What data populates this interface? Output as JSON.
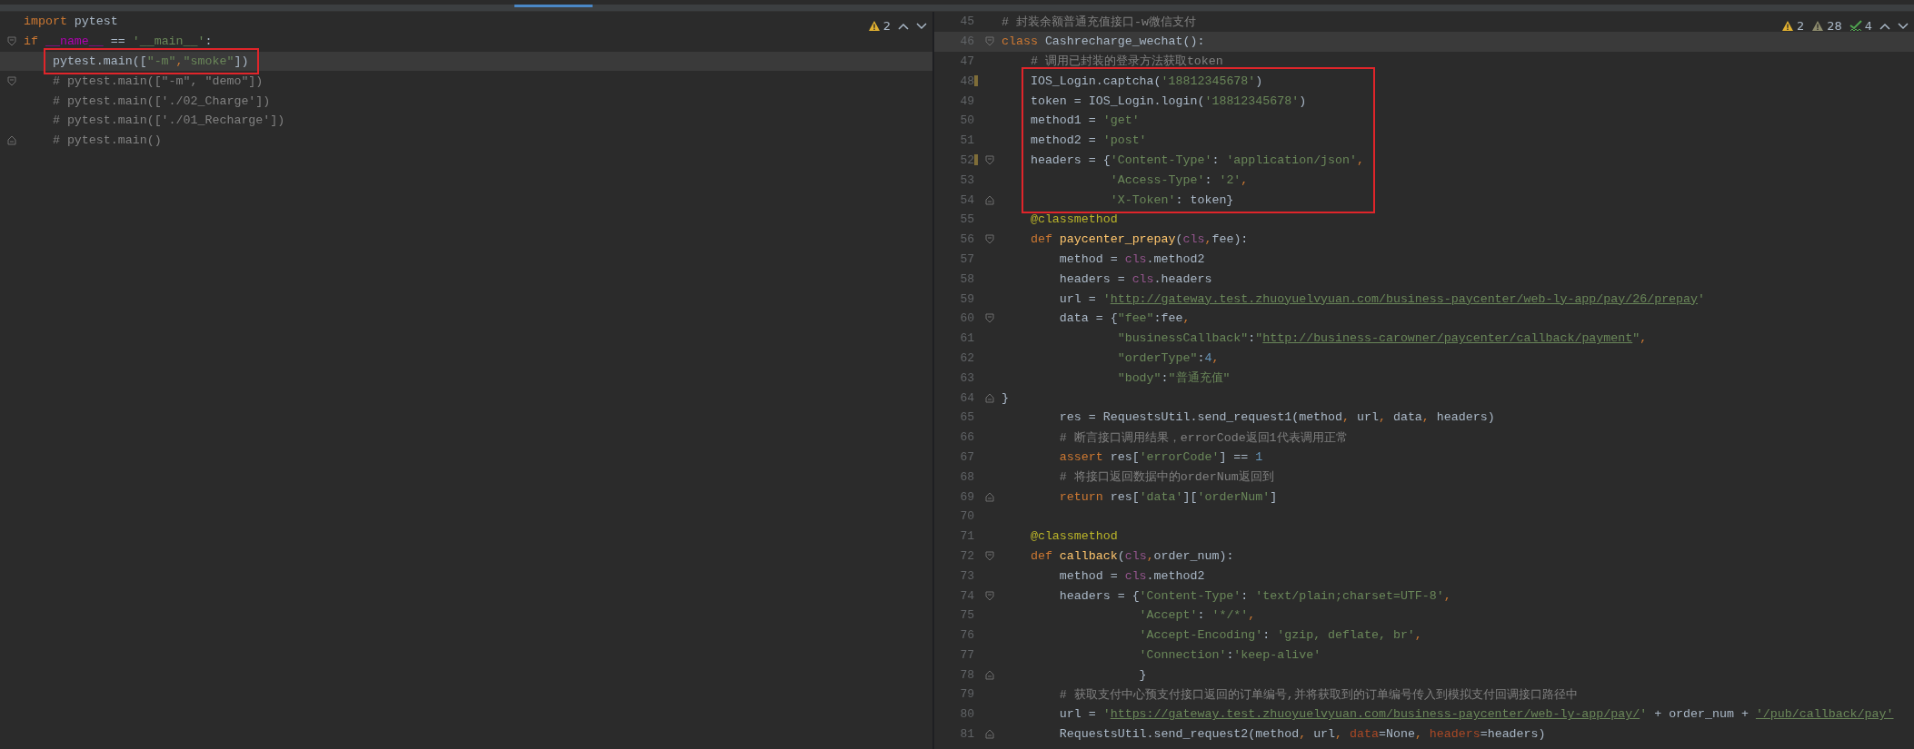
{
  "panes": [
    {
      "inspections": [
        {
          "kind": "warning",
          "count": "2"
        }
      ],
      "lines": [
        {
          "kind": "line",
          "current": false,
          "tokens": [
            {
              "kind": "kw",
              "text": "import "
            },
            {
              "kind": "plain",
              "text": "pytest"
            }
          ]
        },
        {
          "kind": "fold_start",
          "current": false,
          "tokens": [
            {
              "kind": "kw",
              "text": "if "
            },
            {
              "kind": "dunder",
              "text": "__name__"
            },
            {
              "kind": "plain",
              "text": " == "
            },
            {
              "kind": "str",
              "text": "'__main__'"
            },
            {
              "kind": "plain",
              "text": ":"
            }
          ]
        },
        {
          "kind": "frame",
          "lines": [
            {
              "kind": "line",
              "current": true,
              "tokens": [
                {
                  "kind": "plain",
                  "text": "    pytest.main(["
                },
                {
                  "kind": "str",
                  "text": "\"-m\""
                },
                {
                  "kind": "punct",
                  "text": ","
                },
                {
                  "kind": "str",
                  "text": "\"smoke\""
                },
                {
                  "kind": "plain",
                  "text": "])"
                }
              ]
            }
          ]
        },
        {
          "kind": "fold_start",
          "current": false,
          "tokens": [
            {
              "kind": "com",
              "text": "    # pytest.main([\"-m\", \"demo\"])"
            }
          ]
        },
        {
          "kind": "line",
          "current": false,
          "tokens": [
            {
              "kind": "com",
              "text": "    # pytest.main(['./02_Charge'])"
            }
          ]
        },
        {
          "kind": "line",
          "current": false,
          "tokens": [
            {
              "kind": "com",
              "text": "    # pytest.main(['./01_Recharge'])"
            }
          ]
        },
        {
          "kind": "fold_end",
          "current": false,
          "tokens": [
            {
              "kind": "com",
              "text": "    # pytest.main()"
            }
          ]
        }
      ]
    },
    {
      "inspections": [
        {
          "kind": "warning",
          "count": "2"
        },
        {
          "kind": "weak",
          "count": "28"
        },
        {
          "kind": "typo",
          "count": "4"
        }
      ],
      "lines": [
        {
          "kind": "line",
          "number": "45",
          "current": false,
          "changed": false,
          "tokens": [
            {
              "kind": "com",
              "text": "# 封装余额普通充值接口-w微信支付"
            }
          ]
        },
        {
          "kind": "fold_start",
          "number": "46",
          "current": true,
          "changed": false,
          "tokens": [
            {
              "kind": "kw",
              "text": "class "
            },
            {
              "kind": "plain",
              "text": "Cashrecharge_wechat():"
            }
          ]
        },
        {
          "kind": "line",
          "number": "47",
          "current": false,
          "changed": false,
          "tokens": [
            {
              "kind": "com",
              "text": "    # 调用已封装的登录方法获取token"
            }
          ]
        },
        {
          "kind": "frame",
          "lines": [
            {
              "kind": "line",
              "number": "48",
              "current": false,
              "changed": true,
              "tokens": [
                {
                  "kind": "plain",
                  "text": "    IOS_Login.captcha("
                },
                {
                  "kind": "str",
                  "text": "'18812345678'"
                },
                {
                  "kind": "plain",
                  "text": ")"
                }
              ]
            },
            {
              "kind": "line",
              "number": "49",
              "current": false,
              "changed": false,
              "tokens": [
                {
                  "kind": "plain",
                  "text": "    token = IOS_Login.login("
                },
                {
                  "kind": "str",
                  "text": "'18812345678'"
                },
                {
                  "kind": "plain",
                  "text": ")"
                }
              ]
            },
            {
              "kind": "line",
              "number": "50",
              "current": false,
              "changed": false,
              "tokens": [
                {
                  "kind": "plain",
                  "text": "    method1 = "
                },
                {
                  "kind": "str",
                  "text": "'get'"
                }
              ]
            },
            {
              "kind": "line",
              "number": "51",
              "current": false,
              "changed": false,
              "tokens": [
                {
                  "kind": "plain",
                  "text": "    method2 = "
                },
                {
                  "kind": "str",
                  "text": "'post'"
                }
              ]
            },
            {
              "kind": "fold_start",
              "number": "52",
              "current": false,
              "changed": true,
              "tokens": [
                {
                  "kind": "plain",
                  "text": "    headers = {"
                },
                {
                  "kind": "str",
                  "text": "'Content-Type'"
                },
                {
                  "kind": "plain",
                  "text": ": "
                },
                {
                  "kind": "str",
                  "text": "'application/json'"
                },
                {
                  "kind": "punct",
                  "text": ","
                }
              ]
            },
            {
              "kind": "line",
              "number": "53",
              "current": false,
              "changed": false,
              "tokens": [
                {
                  "kind": "str",
                  "text": "               'Access-Type'"
                },
                {
                  "kind": "plain",
                  "text": ": "
                },
                {
                  "kind": "str",
                  "text": "'2'"
                },
                {
                  "kind": "punct",
                  "text": ","
                }
              ]
            },
            {
              "kind": "fold_end",
              "number": "54",
              "current": false,
              "changed": false,
              "tokens": [
                {
                  "kind": "str",
                  "text": "               'X-Token'"
                },
                {
                  "kind": "plain",
                  "text": ": token}"
                }
              ]
            }
          ]
        },
        {
          "kind": "line",
          "number": "55",
          "current": false,
          "changed": false,
          "tokens": [
            {
              "kind": "deco",
              "text": "    @classmethod"
            }
          ]
        },
        {
          "kind": "fold_start",
          "number": "56",
          "current": false,
          "changed": false,
          "tokens": [
            {
              "kind": "kw",
              "text": "    def "
            },
            {
              "kind": "fn",
              "text": "paycenter_prepay"
            },
            {
              "kind": "plain",
              "text": "("
            },
            {
              "kind": "self",
              "text": "cls"
            },
            {
              "kind": "punct",
              "text": ","
            },
            {
              "kind": "plain",
              "text": "fee):"
            }
          ]
        },
        {
          "kind": "line",
          "number": "57",
          "current": false,
          "changed": false,
          "tokens": [
            {
              "kind": "plain",
              "text": "        method = "
            },
            {
              "kind": "self",
              "text": "cls"
            },
            {
              "kind": "plain",
              "text": ".method2"
            }
          ]
        },
        {
          "kind": "line",
          "number": "58",
          "current": false,
          "changed": false,
          "tokens": [
            {
              "kind": "plain",
              "text": "        headers = "
            },
            {
              "kind": "self",
              "text": "cls"
            },
            {
              "kind": "plain",
              "text": ".headers"
            }
          ]
        },
        {
          "kind": "line",
          "number": "59",
          "current": false,
          "changed": false,
          "tokens": [
            {
              "kind": "plain",
              "text": "        url = "
            },
            {
              "kind": "str",
              "text": "'"
            },
            {
              "kind": "url",
              "text": "http://gateway.test.zhuoyuelvyuan.com/business-paycenter/web-ly-app/pay/26/prepay"
            },
            {
              "kind": "str",
              "text": "'"
            }
          ]
        },
        {
          "kind": "fold_start",
          "number": "60",
          "current": false,
          "changed": false,
          "tokens": [
            {
              "kind": "plain",
              "text": "        data = {"
            },
            {
              "kind": "str",
              "text": "\"fee\""
            },
            {
              "kind": "plain",
              "text": ":fee"
            },
            {
              "kind": "punct",
              "text": ","
            }
          ]
        },
        {
          "kind": "line",
          "number": "61",
          "current": false,
          "changed": false,
          "tokens": [
            {
              "kind": "str",
              "text": "                \"businessCallback\""
            },
            {
              "kind": "plain",
              "text": ":"
            },
            {
              "kind": "str",
              "text": "\""
            },
            {
              "kind": "url",
              "text": "http://business-carowner/paycenter/callback/payment"
            },
            {
              "kind": "str",
              "text": "\""
            },
            {
              "kind": "punct",
              "text": ","
            }
          ]
        },
        {
          "kind": "line",
          "number": "62",
          "current": false,
          "changed": false,
          "tokens": [
            {
              "kind": "str",
              "text": "                \"orderType\""
            },
            {
              "kind": "plain",
              "text": ":"
            },
            {
              "kind": "num",
              "text": "4"
            },
            {
              "kind": "punct",
              "text": ","
            }
          ]
        },
        {
          "kind": "line",
          "number": "63",
          "current": false,
          "changed": false,
          "tokens": [
            {
              "kind": "str",
              "text": "                \"body\""
            },
            {
              "kind": "plain",
              "text": ":"
            },
            {
              "kind": "str",
              "text": "\"普通充值\""
            }
          ]
        },
        {
          "kind": "fold_end",
          "number": "64",
          "current": false,
          "changed": false,
          "tokens": [
            {
              "kind": "plain",
              "text": "}"
            }
          ]
        },
        {
          "kind": "line",
          "number": "65",
          "current": false,
          "changed": false,
          "tokens": [
            {
              "kind": "plain",
              "text": "        res = RequestsUtil.send_request1(method"
            },
            {
              "kind": "punct",
              "text": ","
            },
            {
              "kind": "plain",
              "text": " url"
            },
            {
              "kind": "punct",
              "text": ","
            },
            {
              "kind": "plain",
              "text": " data"
            },
            {
              "kind": "punct",
              "text": ","
            },
            {
              "kind": "plain",
              "text": " headers)"
            }
          ]
        },
        {
          "kind": "line",
          "number": "66",
          "current": false,
          "changed": false,
          "tokens": [
            {
              "kind": "com",
              "text": "        # 断言接口调用结果，errorCode返回1代表调用正常"
            }
          ]
        },
        {
          "kind": "line",
          "number": "67",
          "current": false,
          "changed": false,
          "tokens": [
            {
              "kind": "kw",
              "text": "        assert "
            },
            {
              "kind": "plain",
              "text": "res["
            },
            {
              "kind": "str",
              "text": "'errorCode'"
            },
            {
              "kind": "plain",
              "text": "] == "
            },
            {
              "kind": "num",
              "text": "1"
            }
          ]
        },
        {
          "kind": "line",
          "number": "68",
          "current": false,
          "changed": false,
          "tokens": [
            {
              "kind": "com",
              "text": "        # 将接口返回数据中的orderNum返回到"
            }
          ]
        },
        {
          "kind": "fold_end",
          "number": "69",
          "current": false,
          "changed": false,
          "tokens": [
            {
              "kind": "kw",
              "text": "        return "
            },
            {
              "kind": "plain",
              "text": "res["
            },
            {
              "kind": "str",
              "text": "'data'"
            },
            {
              "kind": "plain",
              "text": "]["
            },
            {
              "kind": "str",
              "text": "'orderNum'"
            },
            {
              "kind": "plain",
              "text": "]"
            }
          ]
        },
        {
          "kind": "line",
          "number": "70",
          "current": false,
          "changed": false
        },
        {
          "kind": "line",
          "number": "71",
          "current": false,
          "changed": false,
          "tokens": [
            {
              "kind": "deco",
              "text": "    @classmethod"
            }
          ]
        },
        {
          "kind": "fold_start",
          "number": "72",
          "current": false,
          "changed": false,
          "tokens": [
            {
              "kind": "kw",
              "text": "    def "
            },
            {
              "kind": "fn",
              "text": "callback"
            },
            {
              "kind": "plain",
              "text": "("
            },
            {
              "kind": "self",
              "text": "cls"
            },
            {
              "kind": "punct",
              "text": ","
            },
            {
              "kind": "plain",
              "text": "order_num):"
            }
          ]
        },
        {
          "kind": "line",
          "number": "73",
          "current": false,
          "changed": false,
          "tokens": [
            {
              "kind": "plain",
              "text": "        method = "
            },
            {
              "kind": "self",
              "text": "cls"
            },
            {
              "kind": "plain",
              "text": ".method2"
            }
          ]
        },
        {
          "kind": "fold_start",
          "number": "74",
          "current": false,
          "changed": false,
          "tokens": [
            {
              "kind": "plain",
              "text": "        headers = {"
            },
            {
              "kind": "str",
              "text": "'Content-Type'"
            },
            {
              "kind": "plain",
              "text": ": "
            },
            {
              "kind": "str",
              "text": "'text/plain;charset=UTF-8'"
            },
            {
              "kind": "punct",
              "text": ","
            }
          ]
        },
        {
          "kind": "line",
          "number": "75",
          "current": false,
          "changed": false,
          "tokens": [
            {
              "kind": "str",
              "text": "                   'Accept'"
            },
            {
              "kind": "plain",
              "text": ": "
            },
            {
              "kind": "str",
              "text": "'*/*'"
            },
            {
              "kind": "punct",
              "text": ","
            }
          ]
        },
        {
          "kind": "line",
          "number": "76",
          "current": false,
          "changed": false,
          "tokens": [
            {
              "kind": "str",
              "text": "                   'Accept-Encoding'"
            },
            {
              "kind": "plain",
              "text": ": "
            },
            {
              "kind": "str",
              "text": "'gzip, deflate, br'"
            },
            {
              "kind": "punct",
              "text": ","
            }
          ]
        },
        {
          "kind": "line",
          "number": "77",
          "current": false,
          "changed": false,
          "tokens": [
            {
              "kind": "str",
              "text": "                   'Connection'"
            },
            {
              "kind": "plain",
              "text": ":"
            },
            {
              "kind": "str",
              "text": "'keep-alive'"
            }
          ]
        },
        {
          "kind": "fold_end",
          "number": "78",
          "current": false,
          "changed": false,
          "tokens": [
            {
              "kind": "plain",
              "text": "                   }"
            }
          ]
        },
        {
          "kind": "line",
          "number": "79",
          "current": false,
          "changed": false,
          "tokens": [
            {
              "kind": "com",
              "text": "        # 获取支付中心预支付接口返回的订单编号,并将获取到的订单编号传入到模拟支付回调接口路径中"
            }
          ]
        },
        {
          "kind": "line",
          "number": "80",
          "current": false,
          "changed": false,
          "tokens": [
            {
              "kind": "plain",
              "text": "        url = "
            },
            {
              "kind": "str",
              "text": "'"
            },
            {
              "kind": "url",
              "text": "https://gateway.test.zhuoyuelvyuan.com/business-paycenter/web-ly-app/pay/"
            },
            {
              "kind": "str",
              "text": "'"
            },
            {
              "kind": "plain",
              "text": " + order_num + "
            },
            {
              "kind": "url",
              "text": "'/pub/callback/pay'"
            }
          ]
        },
        {
          "kind": "fold_end",
          "number": "81",
          "current": false,
          "changed": false,
          "tokens": [
            {
              "kind": "plain",
              "text": "        RequestsUtil.send_request2(method"
            },
            {
              "kind": "punct",
              "text": ","
            },
            {
              "kind": "plain",
              "text": " url"
            },
            {
              "kind": "punct",
              "text": ", "
            },
            {
              "kind": "param",
              "text": "data"
            },
            {
              "kind": "plain",
              "text": "=None"
            },
            {
              "kind": "punct",
              "text": ", "
            },
            {
              "kind": "param",
              "text": "headers"
            },
            {
              "kind": "plain",
              "text": "=headers)"
            }
          ]
        }
      ]
    }
  ]
}
